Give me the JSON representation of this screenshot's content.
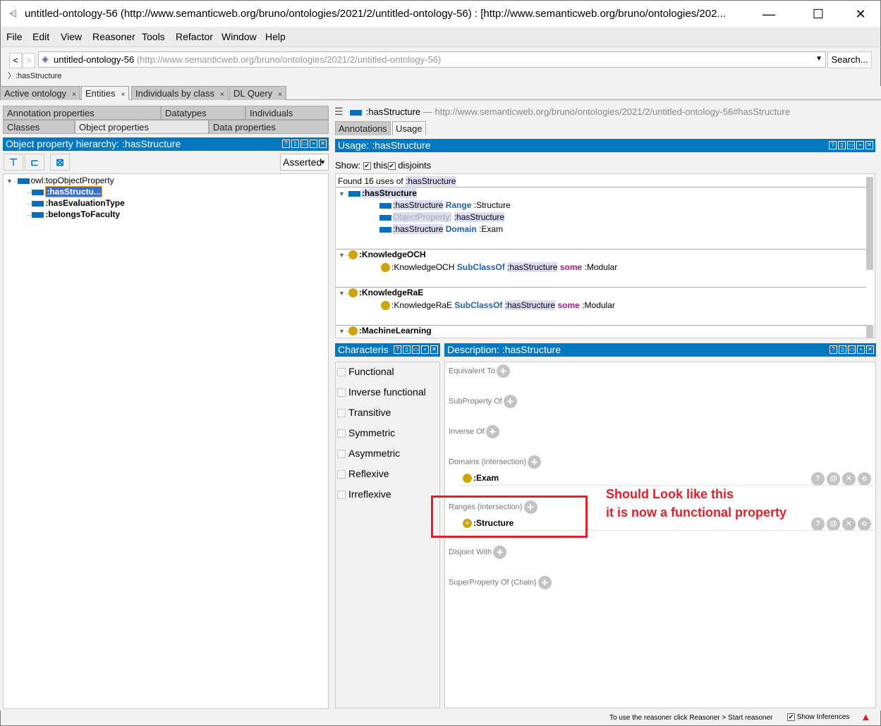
{
  "window": {
    "title": "untitled-ontology-56 (http://www.semanticweb.org/bruno/ontologies/2021/2/untitled-ontology-56)  : [http://www.semanticweb.org/bruno/ontologies/202...",
    "minimize": "—",
    "maximize": "☐",
    "close": "✕"
  },
  "menu": [
    "File",
    "Edit",
    "View",
    "Reasoner",
    "Tools",
    "Refactor",
    "Window",
    "Help"
  ],
  "address": {
    "back": "<",
    "forward": ">",
    "ontology_name": "untitled-ontology-56",
    "ontology_iri": "(http://www.semanticweb.org/bruno/ontologies/2021/2/untitled-ontology-56)",
    "search_label": "Search...",
    "breadcrumb": "〉:hasStructure"
  },
  "main_tabs": [
    {
      "label": "Active ontology",
      "close": "×"
    },
    {
      "label": "Entities",
      "close": "×",
      "active": true
    },
    {
      "label": "Individuals by class",
      "close": "×"
    },
    {
      "label": "DL Query",
      "close": "×"
    }
  ],
  "entity_tabs": {
    "row1": [
      "Annotation properties",
      "Datatypes",
      "Individuals"
    ],
    "row2": [
      "Classes",
      "Object properties",
      "Data properties"
    ],
    "active": "Object properties"
  },
  "hierarchy": {
    "title": "Object property hierarchy: :hasStructure",
    "mode": "Asserted",
    "root": "owl:topObjectProperty",
    "children": [
      ":hasStructu...",
      ":hasEvaluationType",
      ":belongsToFaculty"
    ],
    "selected": ":hasStructu..."
  },
  "entity": {
    "name": ":hasStructure",
    "dash": "—",
    "iri": "http://www.semanticweb.org/bruno/ontologies/2021/2/untitled-ontology-56#hasStructure",
    "tabs": [
      "Annotations",
      "Usage"
    ],
    "active_tab": "Usage"
  },
  "usage": {
    "title": "Usage: :hasStructure",
    "show_label": "Show:",
    "this_label": "this",
    "disjoints_label": "disjoints",
    "this_checked": true,
    "disjoints_checked": true,
    "found_prefix": "Found 16 uses of",
    "found_entity": ":hasStructure",
    "groups": [
      {
        "header": ":hasStructure",
        "lines": [
          {
            "a": ":hasStructure",
            "kw": "Range",
            "b": ":Structure"
          },
          {
            "a": "ObjectProperty:",
            "b": ":hasStructure"
          },
          {
            "a": ":hasStructure",
            "kw": "Domain",
            "b": ":Exam"
          }
        ]
      },
      {
        "header": ":KnowledgeOCH",
        "line": {
          "a": ":KnowledgeOCH",
          "kw": "SubClassOf",
          "p": ":hasStructure",
          "kw2": "some",
          "b": ":Modular"
        }
      },
      {
        "header": ":KnowledgeRaE",
        "line": {
          "a": ":KnowledgeRaE",
          "kw": "SubClassOf",
          "p": ":hasStructure",
          "kw2": "some",
          "b": ":Modular"
        }
      },
      {
        "header": ":MachineLearning"
      }
    ]
  },
  "characteristics": {
    "title": "Characteris",
    "items": [
      {
        "label": "Functional",
        "checked": false
      },
      {
        "label": "Inverse functional",
        "checked": false
      },
      {
        "label": "Transitive",
        "checked": false
      },
      {
        "label": "Symmetric",
        "checked": false
      },
      {
        "label": "Asymmetric",
        "checked": false
      },
      {
        "label": "Reflexive",
        "checked": false
      },
      {
        "label": "Irreflexive",
        "checked": false
      }
    ]
  },
  "description": {
    "title": "Description: :hasStructure",
    "sections": [
      {
        "label": "Equivalent To"
      },
      {
        "label": "SubProperty Of"
      },
      {
        "label": "Inverse Of"
      },
      {
        "label": "Domains (intersection)",
        "value": ":Exam"
      },
      {
        "label": "Ranges (intersection)",
        "value": ":Structure"
      },
      {
        "label": "Disjoint With"
      },
      {
        "label": "SuperProperty Of (Chain)"
      }
    ],
    "actions": [
      "?",
      "@",
      "×",
      "o"
    ]
  },
  "annotation": {
    "line1": "Should Look like this",
    "line2": "it is now a functional property",
    "color": "#e0202a"
  },
  "status": {
    "message": "To use the reasoner click Reasoner > Start reasoner",
    "show_inferences": "Show Inferences",
    "show_inferences_checked": true,
    "warning_icon": "▲"
  },
  "colors": {
    "header_blue": "#0079c1",
    "class_gold": "#cfa40a",
    "keyword_blue": "#1d62b0",
    "keyword_purple": "#b0138f"
  }
}
